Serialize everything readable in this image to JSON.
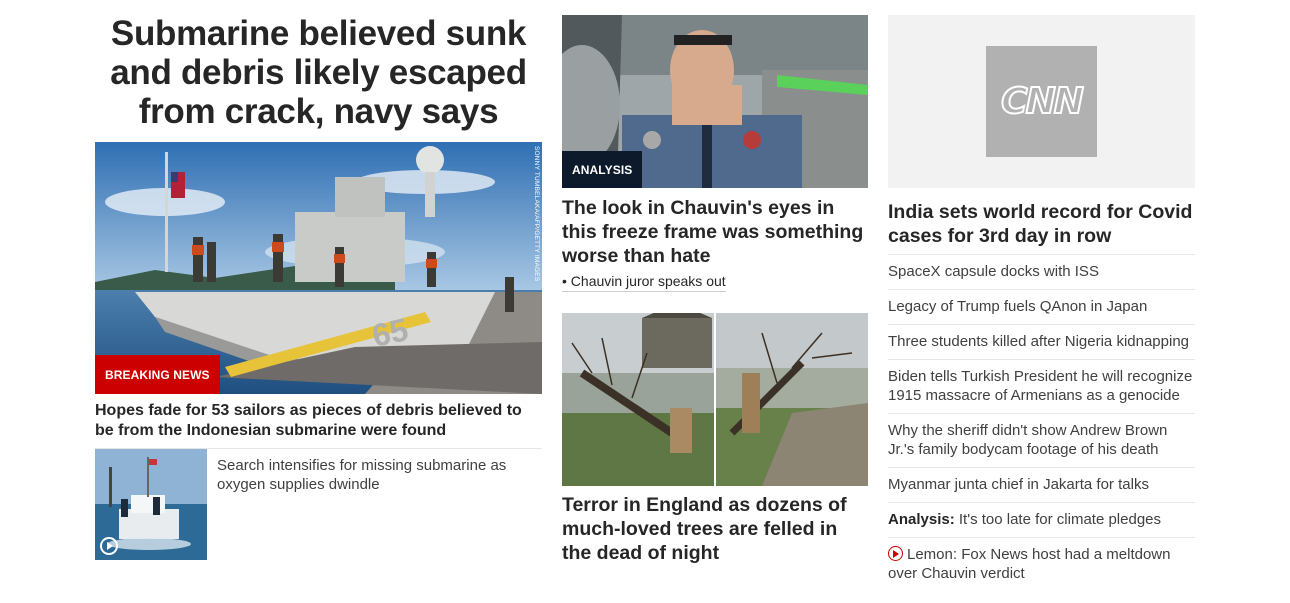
{
  "lead": {
    "headline": "Submarine believed sunk and debris likely escaped from crack, navy says",
    "badge": "BREAKING NEWS",
    "photo_credit": "SONNY TUMBELAKA/AFP/GETTY IMAGES",
    "caption": "Hopes fade for 53 sailors as pieces of debris believed to be from the Indonesian submarine were found",
    "secondary": {
      "text": "Search intensifies for missing submarine as oxygen supplies dwindle"
    }
  },
  "middle": {
    "story1": {
      "badge": "ANALYSIS",
      "headline": "The look in Chauvin's eyes in this freeze frame was something worse than hate",
      "related": "• Chauvin juror speaks out"
    },
    "story2": {
      "headline": "Terror in England as dozens of much-loved trees are felled in the dead of night"
    }
  },
  "right": {
    "logo_text": "CNN",
    "headline": "India sets world record for Covid cases for 3rd day in row",
    "items": [
      {
        "prefix": "",
        "text": "SpaceX capsule docks with ISS"
      },
      {
        "prefix": "",
        "text": "Legacy of Trump fuels QAnon in Japan"
      },
      {
        "prefix": "",
        "text": "Three students killed after Nigeria kidnapping"
      },
      {
        "prefix": "",
        "text": "Biden tells Turkish President he will recognize 1915 massacre of Armenians as a genocide"
      },
      {
        "prefix": "",
        "text": "Why the sheriff didn't show Andrew Brown Jr.'s family bodycam footage of his death"
      },
      {
        "prefix": "",
        "text": "Myanmar junta chief in Jakarta for talks"
      },
      {
        "prefix": "Analysis:",
        "text": " It's too late for climate pledges"
      },
      {
        "prefix": "",
        "text": "Lemon: Fox News host had a meltdown over Chauvin verdict",
        "icon": "play-circle-icon"
      }
    ]
  },
  "colors": {
    "breaking": "#cc0000",
    "analysis": "#0c1a2b",
    "text": "#262626",
    "divider": "#e6e6e6"
  }
}
